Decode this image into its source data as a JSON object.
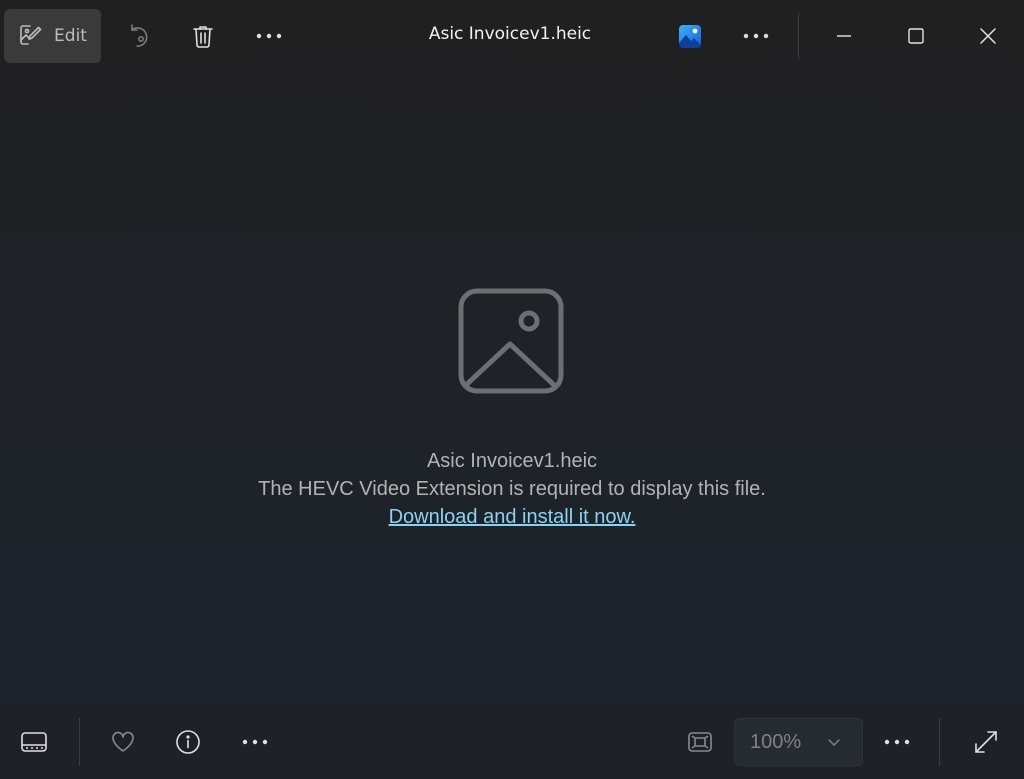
{
  "toolbar": {
    "edit_label": "Edit",
    "title": "Asic Invoicev1.heic"
  },
  "icons": {
    "edit": "image-edit-icon",
    "rotate": "rotate-icon",
    "delete": "trash-icon",
    "more": "ellipsis-icon",
    "app": "photos-app-icon",
    "minimize": "minimize-icon",
    "maximize": "maximize-icon",
    "close": "close-icon",
    "placeholder": "image-placeholder-icon",
    "filmstrip": "filmstrip-icon",
    "favorite": "heart-icon",
    "info": "info-icon",
    "fit": "fit-to-window-icon",
    "chevron": "chevron-down-icon",
    "fullscreen": "fullscreen-icon"
  },
  "message": {
    "file_name": "Asic Invoicev1.heic",
    "requirement": "The HEVC Video Extension is required to display this file.",
    "link": "Download and install it now."
  },
  "bottombar": {
    "zoom_value": "100%"
  },
  "colors": {
    "link": "#8ad4f2",
    "background": "#1f2228",
    "edit_button_bg": "#3a3a3a"
  }
}
